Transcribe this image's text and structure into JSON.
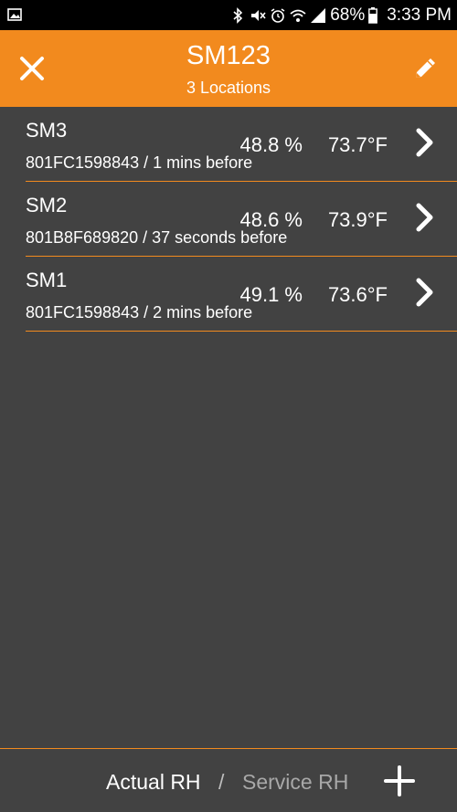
{
  "status_bar": {
    "battery": "68%",
    "time": "3:33 PM",
    "icons": [
      "image-icon",
      "bluetooth-icon",
      "mute-icon",
      "alarm-icon",
      "wifi-icon",
      "signal-icon",
      "battery-icon"
    ]
  },
  "header": {
    "title": "SM123",
    "subtitle": "3 Locations",
    "background_color": "#F28A1E",
    "close_icon": "close-icon",
    "edit_icon": "pencil-icon"
  },
  "locations": [
    {
      "name": "SM3",
      "id_info": "801FC1598843 / 1 mins before",
      "rh": "48.8 %",
      "temp": "73.7°F"
    },
    {
      "name": "SM2",
      "id_info": "801B8F689820 / 37 seconds before",
      "rh": "48.6 %",
      "temp": "73.9°F"
    },
    {
      "name": "SM1",
      "id_info": "801FC1598843 / 2 mins before",
      "rh": "49.1 %",
      "temp": "73.6°F"
    }
  ],
  "footer": {
    "actual_rh": "Actual RH",
    "separator": "/",
    "service_rh": "Service RH",
    "add_icon": "plus-icon"
  }
}
